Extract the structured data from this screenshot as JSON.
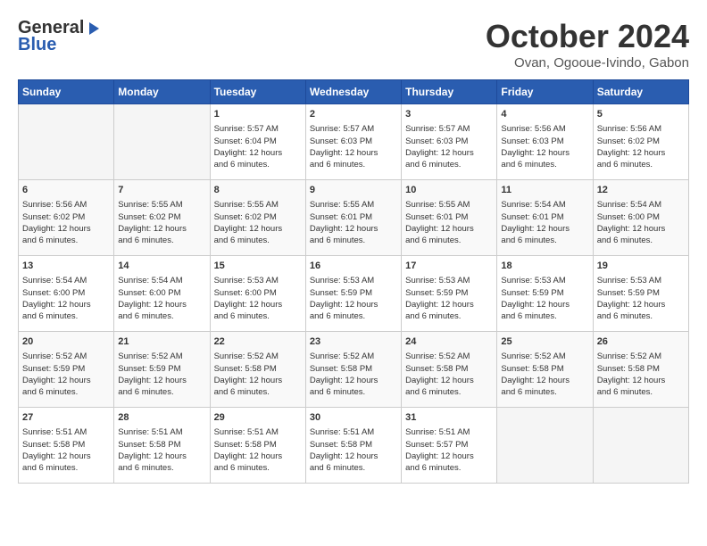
{
  "header": {
    "logo_general": "General",
    "logo_blue": "Blue",
    "month": "October 2024",
    "location": "Ovan, Ogooue-Ivindo, Gabon"
  },
  "days_of_week": [
    "Sunday",
    "Monday",
    "Tuesday",
    "Wednesday",
    "Thursday",
    "Friday",
    "Saturday"
  ],
  "weeks": [
    [
      {
        "day": "",
        "content": ""
      },
      {
        "day": "",
        "content": ""
      },
      {
        "day": "1",
        "content": "Sunrise: 5:57 AM\nSunset: 6:04 PM\nDaylight: 12 hours\nand 6 minutes."
      },
      {
        "day": "2",
        "content": "Sunrise: 5:57 AM\nSunset: 6:03 PM\nDaylight: 12 hours\nand 6 minutes."
      },
      {
        "day": "3",
        "content": "Sunrise: 5:57 AM\nSunset: 6:03 PM\nDaylight: 12 hours\nand 6 minutes."
      },
      {
        "day": "4",
        "content": "Sunrise: 5:56 AM\nSunset: 6:03 PM\nDaylight: 12 hours\nand 6 minutes."
      },
      {
        "day": "5",
        "content": "Sunrise: 5:56 AM\nSunset: 6:02 PM\nDaylight: 12 hours\nand 6 minutes."
      }
    ],
    [
      {
        "day": "6",
        "content": "Sunrise: 5:56 AM\nSunset: 6:02 PM\nDaylight: 12 hours\nand 6 minutes."
      },
      {
        "day": "7",
        "content": "Sunrise: 5:55 AM\nSunset: 6:02 PM\nDaylight: 12 hours\nand 6 minutes."
      },
      {
        "day": "8",
        "content": "Sunrise: 5:55 AM\nSunset: 6:02 PM\nDaylight: 12 hours\nand 6 minutes."
      },
      {
        "day": "9",
        "content": "Sunrise: 5:55 AM\nSunset: 6:01 PM\nDaylight: 12 hours\nand 6 minutes."
      },
      {
        "day": "10",
        "content": "Sunrise: 5:55 AM\nSunset: 6:01 PM\nDaylight: 12 hours\nand 6 minutes."
      },
      {
        "day": "11",
        "content": "Sunrise: 5:54 AM\nSunset: 6:01 PM\nDaylight: 12 hours\nand 6 minutes."
      },
      {
        "day": "12",
        "content": "Sunrise: 5:54 AM\nSunset: 6:00 PM\nDaylight: 12 hours\nand 6 minutes."
      }
    ],
    [
      {
        "day": "13",
        "content": "Sunrise: 5:54 AM\nSunset: 6:00 PM\nDaylight: 12 hours\nand 6 minutes."
      },
      {
        "day": "14",
        "content": "Sunrise: 5:54 AM\nSunset: 6:00 PM\nDaylight: 12 hours\nand 6 minutes."
      },
      {
        "day": "15",
        "content": "Sunrise: 5:53 AM\nSunset: 6:00 PM\nDaylight: 12 hours\nand 6 minutes."
      },
      {
        "day": "16",
        "content": "Sunrise: 5:53 AM\nSunset: 5:59 PM\nDaylight: 12 hours\nand 6 minutes."
      },
      {
        "day": "17",
        "content": "Sunrise: 5:53 AM\nSunset: 5:59 PM\nDaylight: 12 hours\nand 6 minutes."
      },
      {
        "day": "18",
        "content": "Sunrise: 5:53 AM\nSunset: 5:59 PM\nDaylight: 12 hours\nand 6 minutes."
      },
      {
        "day": "19",
        "content": "Sunrise: 5:53 AM\nSunset: 5:59 PM\nDaylight: 12 hours\nand 6 minutes."
      }
    ],
    [
      {
        "day": "20",
        "content": "Sunrise: 5:52 AM\nSunset: 5:59 PM\nDaylight: 12 hours\nand 6 minutes."
      },
      {
        "day": "21",
        "content": "Sunrise: 5:52 AM\nSunset: 5:59 PM\nDaylight: 12 hours\nand 6 minutes."
      },
      {
        "day": "22",
        "content": "Sunrise: 5:52 AM\nSunset: 5:58 PM\nDaylight: 12 hours\nand 6 minutes."
      },
      {
        "day": "23",
        "content": "Sunrise: 5:52 AM\nSunset: 5:58 PM\nDaylight: 12 hours\nand 6 minutes."
      },
      {
        "day": "24",
        "content": "Sunrise: 5:52 AM\nSunset: 5:58 PM\nDaylight: 12 hours\nand 6 minutes."
      },
      {
        "day": "25",
        "content": "Sunrise: 5:52 AM\nSunset: 5:58 PM\nDaylight: 12 hours\nand 6 minutes."
      },
      {
        "day": "26",
        "content": "Sunrise: 5:52 AM\nSunset: 5:58 PM\nDaylight: 12 hours\nand 6 minutes."
      }
    ],
    [
      {
        "day": "27",
        "content": "Sunrise: 5:51 AM\nSunset: 5:58 PM\nDaylight: 12 hours\nand 6 minutes."
      },
      {
        "day": "28",
        "content": "Sunrise: 5:51 AM\nSunset: 5:58 PM\nDaylight: 12 hours\nand 6 minutes."
      },
      {
        "day": "29",
        "content": "Sunrise: 5:51 AM\nSunset: 5:58 PM\nDaylight: 12 hours\nand 6 minutes."
      },
      {
        "day": "30",
        "content": "Sunrise: 5:51 AM\nSunset: 5:58 PM\nDaylight: 12 hours\nand 6 minutes."
      },
      {
        "day": "31",
        "content": "Sunrise: 5:51 AM\nSunset: 5:57 PM\nDaylight: 12 hours\nand 6 minutes."
      },
      {
        "day": "",
        "content": ""
      },
      {
        "day": "",
        "content": ""
      }
    ]
  ]
}
